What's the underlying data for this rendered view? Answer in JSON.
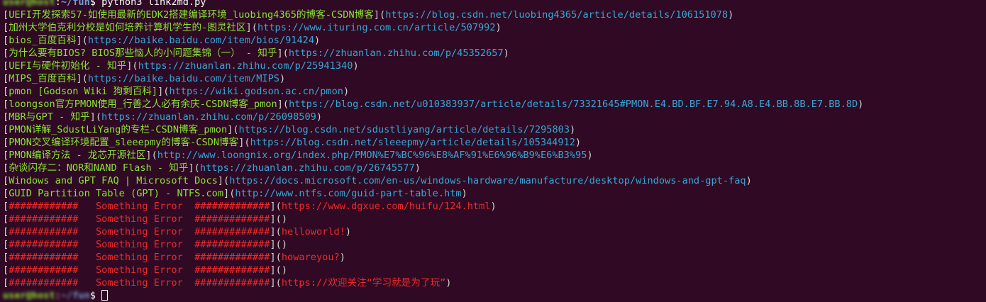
{
  "prompt": {
    "user_host": "user@host",
    "path": "~/fun",
    "symbol": "$",
    "command": "python3 link2md.py"
  },
  "colors": {
    "background": "#300a24",
    "title": "#8ae234",
    "url": "#34a7d6",
    "error": "#ef2929",
    "text": "#d3d7cf"
  },
  "links": [
    {
      "title": "UEFI开发探索57-如使用最新的EDK2搭建编译环境_luobing4365的博客-CSDN博客",
      "url": "https://blog.csdn.net/luobing4365/article/details/106151078"
    },
    {
      "title": "加州大学伯克利分校是如何培养计算机学生的-图灵社区",
      "url": "https://www.ituring.com.cn/article/507992"
    },
    {
      "title": "bios_百度百科",
      "url": "https://baike.baidu.com/item/bios/91424"
    },
    {
      "title": "为什么要有BIOS? BIOS那些恼人的小问题集锦（一） - 知乎",
      "url": "https://zhuanlan.zhihu.com/p/45352657"
    },
    {
      "title": "UEFI与硬件初始化 - 知乎",
      "url": "https://zhuanlan.zhihu.com/p/25941340"
    },
    {
      "title": "MIPS_百度百科",
      "url": "https://baike.baidu.com/item/MIPS"
    },
    {
      "title": "pmon [Godson Wiki 狗剩百科]",
      "url": "https://wiki.godson.ac.cn/pmon"
    },
    {
      "title": "loongson官方PMON使用_行善之人必有余庆-CSDN博客_pmon",
      "url": "https://blog.csdn.net/u010383937/article/details/73321645#PMON.E4.BD.BF.E7.94.A8.E4.BB.8B.E7.BB.8D"
    },
    {
      "title": "MBR与GPT - 知乎",
      "url": "https://zhuanlan.zhihu.com/p/26098509"
    },
    {
      "title": "PMON详解_SdustLiYang的专栏-CSDN博客_pmon",
      "url": "https://blog.csdn.net/sdustliyang/article/details/7295803"
    },
    {
      "title": "PMON交叉编译环境配置_sleeepmy的博客-CSDN博客",
      "url": "https://blog.csdn.net/sleeepmy/article/details/105344912"
    },
    {
      "title": "PMON编译方法 - 龙芯开源社区",
      "url": "http://www.loongnix.org/index.php/PMON%E7%BC%96%E8%AF%91%E6%96%B9%E6%B3%95"
    },
    {
      "title": "杂谈闪存二：NOR和NAND Flash - 知乎",
      "url": "https://zhuanlan.zhihu.com/p/26745577"
    },
    {
      "title": "Windows and GPT FAQ | Microsoft Docs",
      "url": "https://docs.microsoft.com/en-us/windows-hardware/manufacture/desktop/windows-and-gpt-faq"
    },
    {
      "title": "GUID Partition Table (GPT) - NTFS.com",
      "url": "http://www.ntfs.com/guid-part-table.htm"
    }
  ],
  "errors": [
    {
      "text": "############   Something Error  #############",
      "url": "https://www.dgxue.com/huifu/124.html"
    },
    {
      "text": "############   Something Error  #############",
      "url": ""
    },
    {
      "text": "############   Something Error  #############",
      "url": "helloworld!"
    },
    {
      "text": "############   Something Error  #############",
      "url": ""
    },
    {
      "text": "############   Something Error  #############",
      "url": "howareyou?"
    },
    {
      "text": "############   Something Error  #############",
      "url": ""
    },
    {
      "text": "############   Something Error  #############",
      "url": "https://欢迎关注“学习就是为了玩”"
    }
  ]
}
